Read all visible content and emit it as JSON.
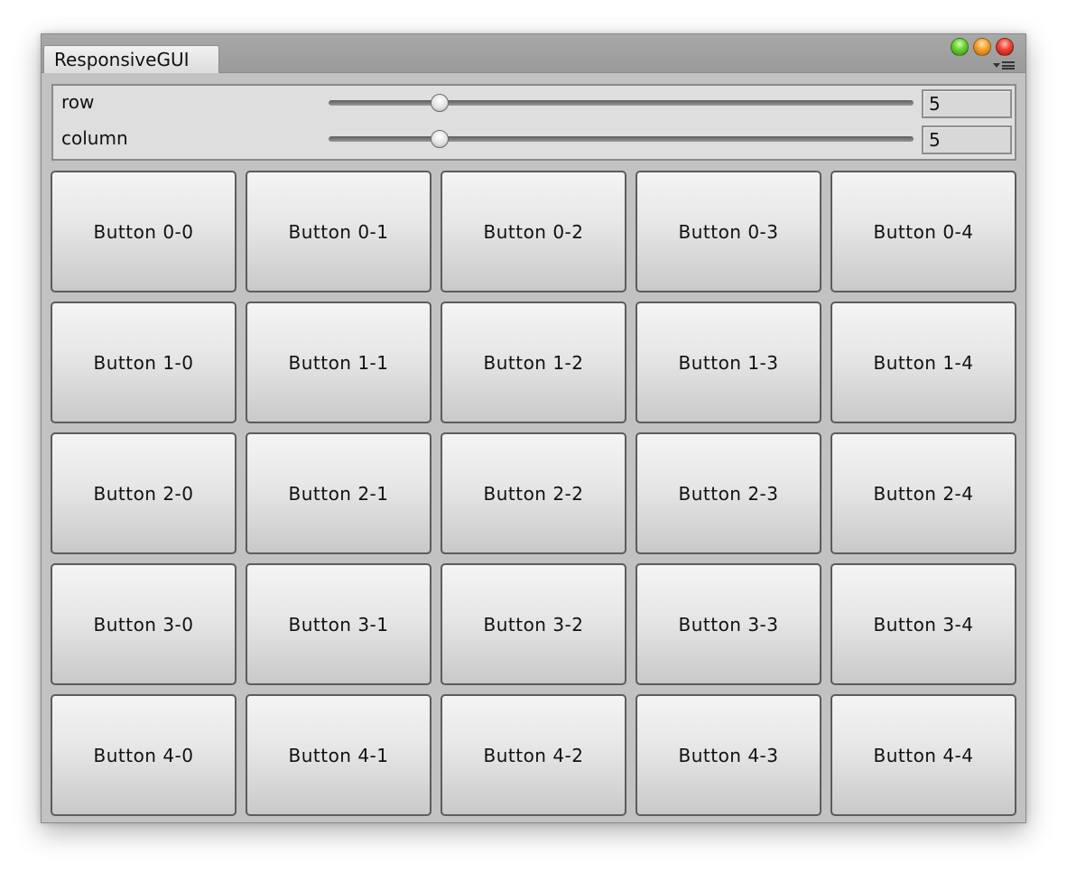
{
  "window": {
    "tab_title": "ResponsiveGUI",
    "window_buttons": [
      "green-zoom-icon",
      "orange-minimize-icon",
      "red-close-icon"
    ],
    "menu_icon": "panel-menu-icon"
  },
  "controls": {
    "row": {
      "label": "row",
      "value": "5",
      "slider_fraction": 0.18
    },
    "column": {
      "label": "column",
      "value": "5",
      "slider_fraction": 0.18
    }
  },
  "grid": {
    "rows": [
      [
        "Button 0-0",
        "Button 0-1",
        "Button 0-2",
        "Button 0-3",
        "Button 0-4"
      ],
      [
        "Button 1-0",
        "Button 1-1",
        "Button 1-2",
        "Button 1-3",
        "Button 1-4"
      ],
      [
        "Button 2-0",
        "Button 2-1",
        "Button 2-2",
        "Button 2-3",
        "Button 2-4"
      ],
      [
        "Button 3-0",
        "Button 3-1",
        "Button 3-2",
        "Button 3-3",
        "Button 3-4"
      ],
      [
        "Button 4-0",
        "Button 4-1",
        "Button 4-2",
        "Button 4-3",
        "Button 4-4"
      ]
    ]
  }
}
